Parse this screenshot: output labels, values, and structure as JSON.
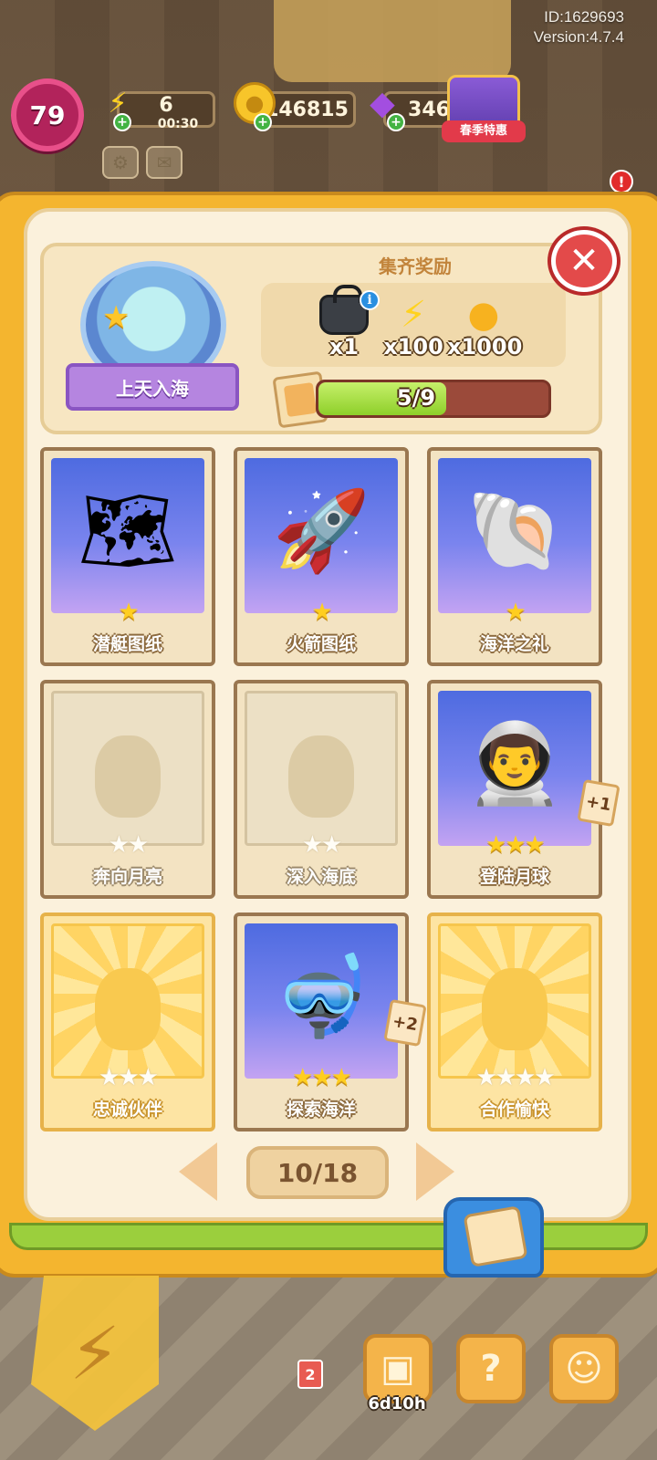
{
  "hud": {
    "id_text": "ID:1629693",
    "version_text": "Version:4.7.4",
    "level": "79",
    "energy": "6",
    "energy_timer": "00:30",
    "coins": "146815",
    "gems": "346",
    "promo_label": "春季特惠",
    "notification_count": "!"
  },
  "album": {
    "set_name": "上天入海",
    "reward_title": "集齐奖励",
    "rewards": [
      {
        "icon": "bag-icon",
        "count": "x1"
      },
      {
        "icon": "energy-icon",
        "count": "x100"
      },
      {
        "icon": "coins-icon",
        "count": "x1000"
      }
    ],
    "progress_text": "5/9",
    "progress_fraction": 0.5556
  },
  "cards": [
    {
      "name": "潜艇图纸",
      "stars": 1,
      "collected": true,
      "art": "submarine-blueprint",
      "extra": ""
    },
    {
      "name": "火箭图纸",
      "stars": 1,
      "collected": true,
      "art": "rocket-blueprint",
      "extra": ""
    },
    {
      "name": "海洋之礼",
      "stars": 1,
      "collected": true,
      "art": "pearl-shell",
      "extra": ""
    },
    {
      "name": "奔向月亮",
      "stars": 2,
      "collected": false,
      "art": "locked",
      "extra": ""
    },
    {
      "name": "深入海底",
      "stars": 2,
      "collected": false,
      "art": "locked",
      "extra": ""
    },
    {
      "name": "登陆月球",
      "stars": 3,
      "collected": true,
      "art": "astronaut",
      "extra": "+1"
    },
    {
      "name": "忠诚伙伴",
      "stars": 3,
      "collected": false,
      "art": "locked-gold",
      "extra": ""
    },
    {
      "name": "探索海洋",
      "stars": 3,
      "collected": true,
      "art": "diver",
      "extra": "+2"
    },
    {
      "name": "合作愉快",
      "stars": 4,
      "collected": false,
      "art": "locked-gold",
      "extra": ""
    }
  ],
  "pager": {
    "page_text": "10/18"
  },
  "bottom": {
    "timer": "6d10h",
    "badge": "2"
  }
}
